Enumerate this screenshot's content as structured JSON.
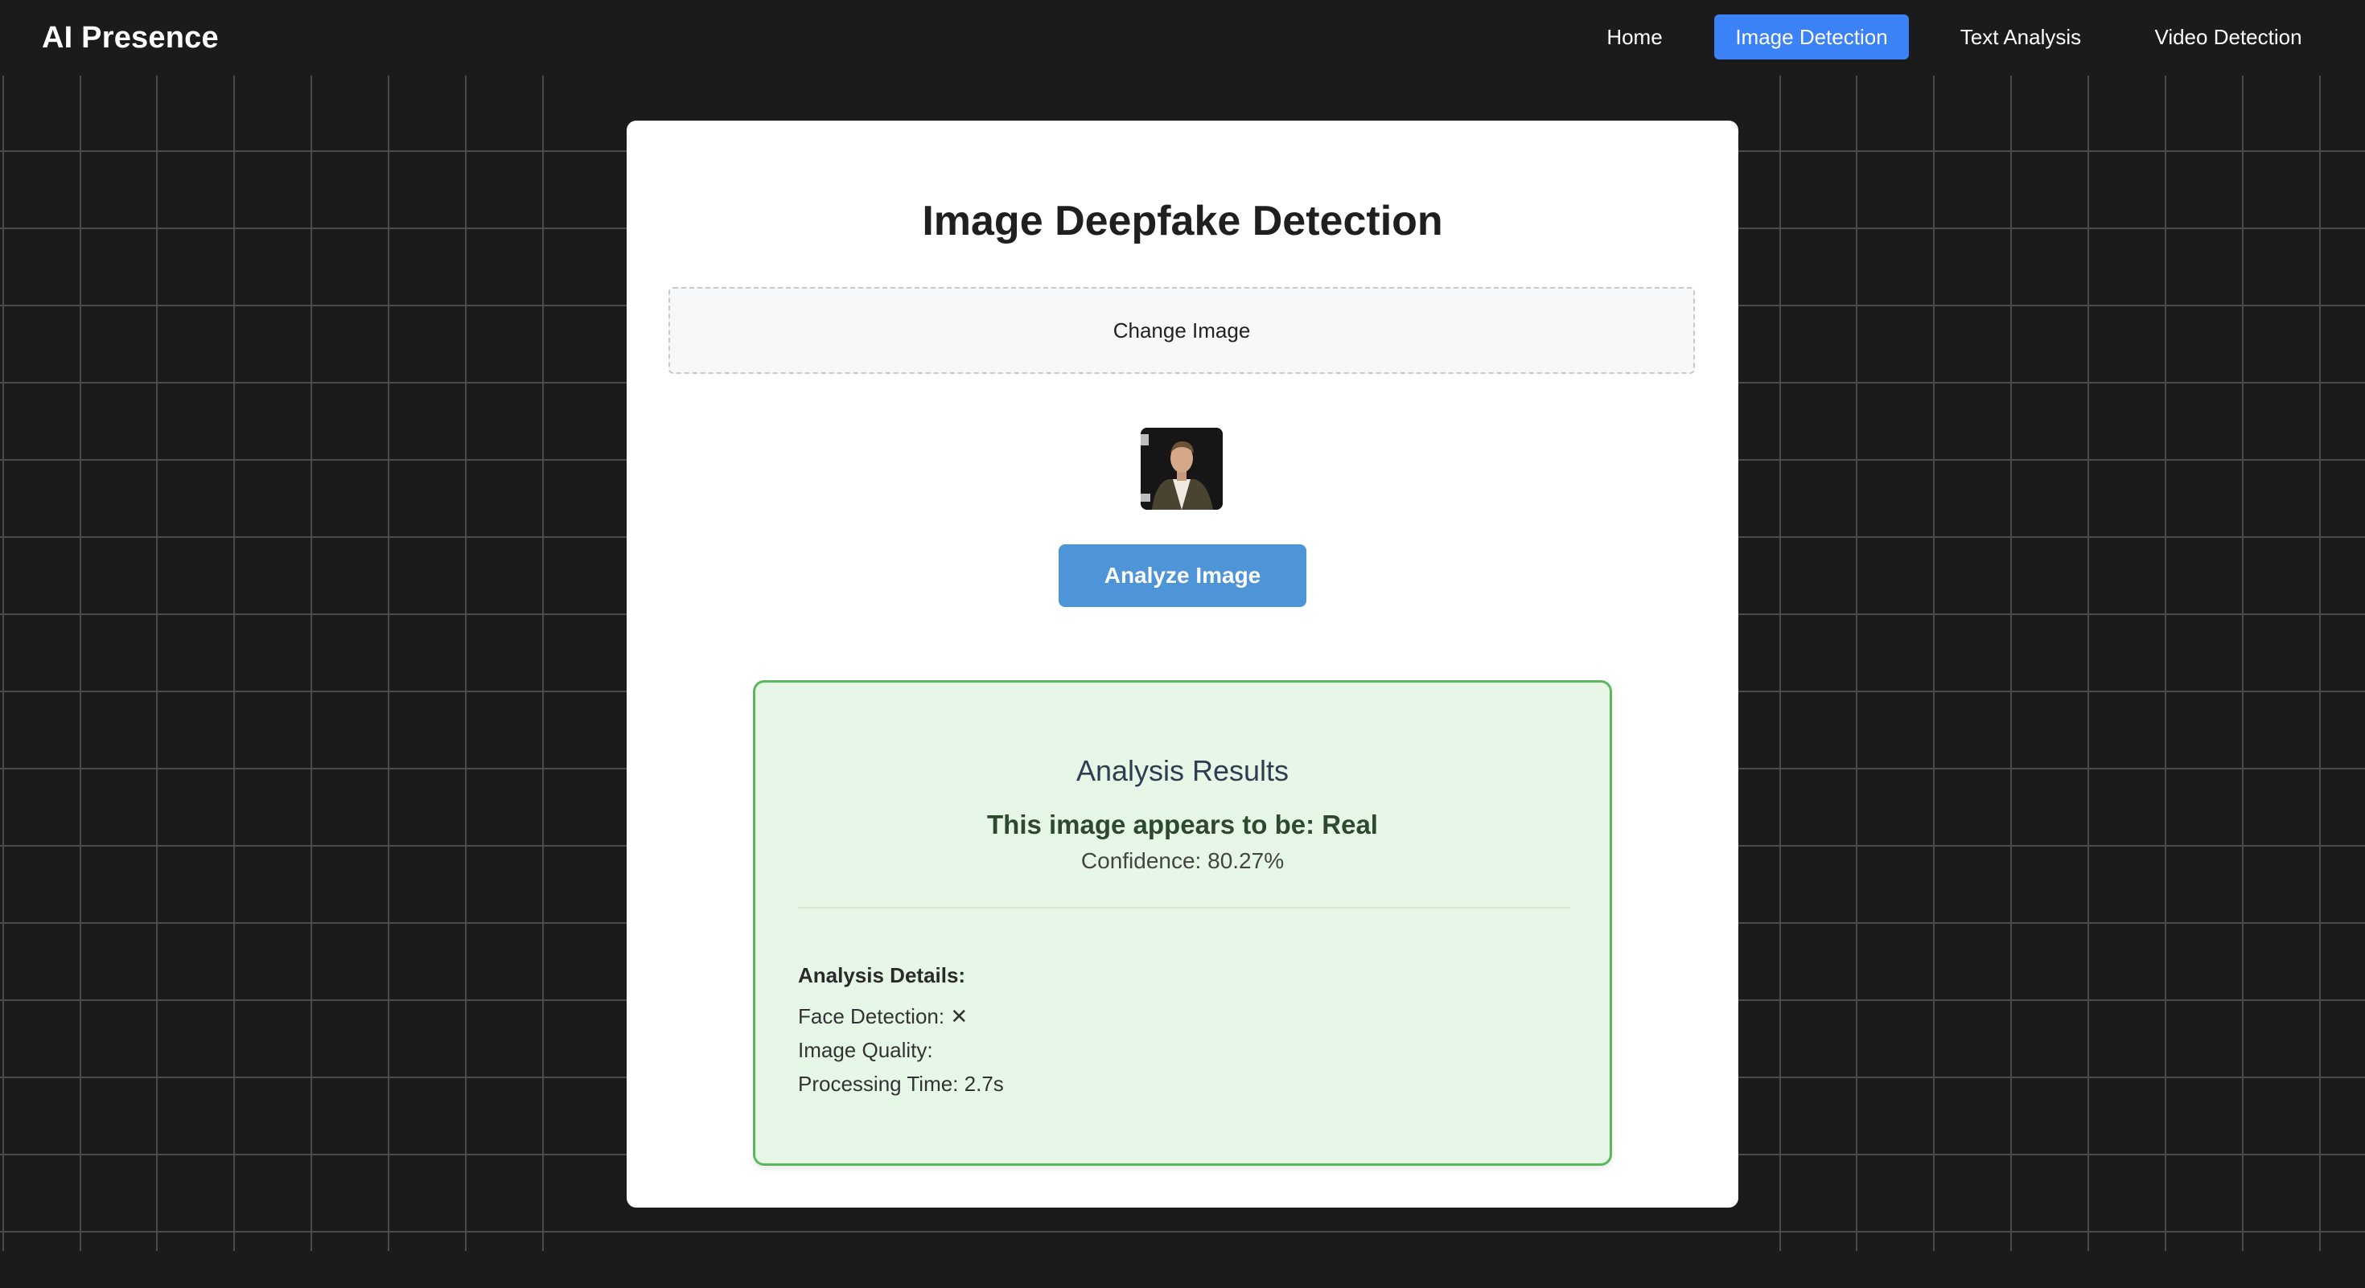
{
  "nav": {
    "brand": "AI Presence",
    "links": [
      {
        "label": "Home",
        "active": false
      },
      {
        "label": "Image Detection",
        "active": true
      },
      {
        "label": "Text Analysis",
        "active": false
      },
      {
        "label": "Video Detection",
        "active": false
      }
    ]
  },
  "main": {
    "title": "Image Deepfake Detection",
    "upload_label": "Change Image",
    "analyze_label": "Analyze Image"
  },
  "results": {
    "title": "Analysis Results",
    "verdict": "This image appears to be: Real",
    "confidence": "Confidence: 80.27%",
    "details_title": "Analysis Details:",
    "face_detection": "Face Detection: ✕",
    "image_quality": "Image Quality:",
    "processing_time": "Processing Time: 2.7s"
  },
  "colors": {
    "background": "#1b1b1b",
    "accent": "#3b82f6",
    "analyze_button": "#4e95d8",
    "result_border": "#5cb85c",
    "result_bg": "#e6f7e7"
  }
}
